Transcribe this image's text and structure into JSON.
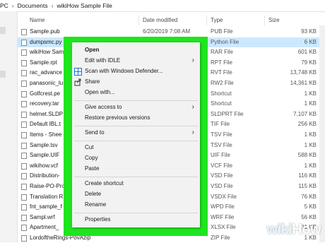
{
  "breadcrumb": {
    "parts": [
      "PC",
      "Documents",
      "wikiHow Sample File"
    ]
  },
  "columns": {
    "name": "Name",
    "date": "Date modified",
    "type": "Type",
    "size": "Size"
  },
  "files": [
    {
      "name": "Sample.pub",
      "date": "6/20/2019 7:08 AM",
      "type": "PUB File",
      "size": "93 KB",
      "selected": false
    },
    {
      "name": "dumpsmc.py",
      "date": "",
      "type": "Python File",
      "size": "6 KB",
      "selected": true
    },
    {
      "name": "wikiHow Sam",
      "date": "",
      "type": "RAR File",
      "size": "601 KB",
      "selected": false
    },
    {
      "name": "Sample.rpt",
      "date": "",
      "type": "RPT File",
      "size": "79 KB",
      "selected": false
    },
    {
      "name": "rac_advance",
      "date": "",
      "type": "RVT File",
      "size": "13,748 KB",
      "selected": false
    },
    {
      "name": "panasonic_lu",
      "date": "",
      "type": "RW2 File",
      "size": "14,361 KB",
      "selected": false
    },
    {
      "name": "Golfcrest.pe",
      "date": "",
      "type": "Shortcut",
      "size": "1 KB",
      "selected": false
    },
    {
      "name": "recovery.tar",
      "date": "",
      "type": "Shortcut",
      "size": "1 KB",
      "selected": false
    },
    {
      "name": "helmet.SLDP",
      "date": "",
      "type": "SLDPRT File",
      "size": "7,107 KB",
      "selected": false
    },
    {
      "name": "Default IBL.t",
      "date": "",
      "type": "TIF File",
      "size": "256 KB",
      "selected": false
    },
    {
      "name": "Items - Shee",
      "date": "",
      "type": "TSV File",
      "size": "1 KB",
      "selected": false
    },
    {
      "name": "Sample.tsv",
      "date": "",
      "type": "TSV File",
      "size": "1 KB",
      "selected": false
    },
    {
      "name": "Sample.UIF",
      "date": "",
      "type": "UIF File",
      "size": "588 KB",
      "selected": false
    },
    {
      "name": "wikihow.vcf",
      "date": "",
      "type": "VCF File",
      "size": "1 KB",
      "selected": false
    },
    {
      "name": "Distribution-",
      "date": "",
      "type": "VSD File",
      "size": "116 KB",
      "selected": false
    },
    {
      "name": "Raise-PO-Pro",
      "date": "",
      "type": "VSD File",
      "size": "115 KB",
      "selected": false
    },
    {
      "name": "Translation R",
      "date": "",
      "type": "VSDX File",
      "size": "76 KB",
      "selected": false
    },
    {
      "name": "fnt_sample_f",
      "date": "",
      "type": "WPD File",
      "size": "5 KB",
      "selected": false
    },
    {
      "name": "Sampl.wrf",
      "date": "",
      "type": "WRF File",
      "size": "56 KB",
      "selected": false
    },
    {
      "name": "Apartment_",
      "date": "",
      "type": "XLSX File",
      "size": "11 KB",
      "selected": false
    },
    {
      "name": "LordoftheRings-PovAzip",
      "date": "",
      "type": "ZIP File",
      "size": "1 KB",
      "selected": false
    }
  ],
  "context_menu": {
    "open": "Open",
    "edit_idle": "Edit with IDLE",
    "scan": "Scan with Windows Defender...",
    "share": "Share",
    "open_with": "Open with...",
    "give_access": "Give access to",
    "restore": "Restore previous versions",
    "send_to": "Send to",
    "cut": "Cut",
    "copy": "Copy",
    "paste": "Paste",
    "create_shortcut": "Create shortcut",
    "delete": "Delete",
    "rename": "Rename",
    "properties": "Properties"
  },
  "icons": {
    "submenu": "chevron-right-icon",
    "defender": "shield-icon",
    "share": "share-icon"
  },
  "colors": {
    "highlight": "#1ee51e",
    "selection": "#cce8ff",
    "menu_bg": "#f2f2f2"
  },
  "watermark": {
    "wiki": "wiki",
    "how": "How"
  }
}
